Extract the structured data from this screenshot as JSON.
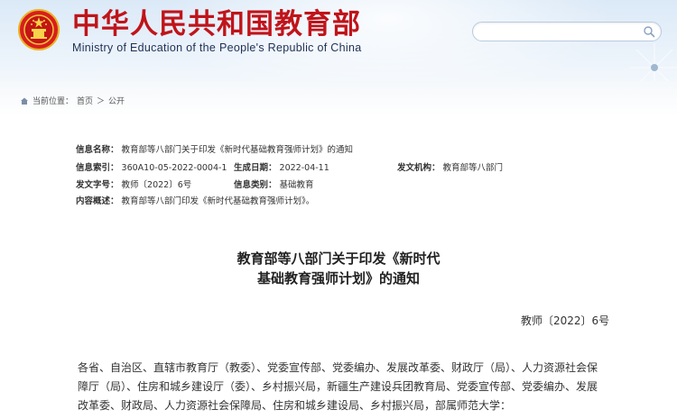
{
  "header": {
    "title": "中华人民共和国教育部",
    "subtitle": "Ministry of Education of the People's Republic of China",
    "search_placeholder": ""
  },
  "breadcrumb": {
    "current_location_label": "当前位置：",
    "home": "首页",
    "separator": "＞",
    "section": "公开"
  },
  "meta": {
    "name_label": "信息名称：",
    "name_value": "教育部等八部门关于印发《新时代基础教育强师计划》的通知",
    "index_label": "信息索引：",
    "index_value": "360A10-05-2022-0004-1",
    "date_label": "生成日期：",
    "date_value": "2022-04-11",
    "issuer_label": "发文机构：",
    "issuer_value": "教育部等八部门",
    "docno_label": "发文字号：",
    "docno_value": "教师〔2022〕6号",
    "category_label": "信息类别：",
    "category_value": "基础教育",
    "summary_label": "内容概述：",
    "summary_value": "教育部等八部门印发《新时代基础教育强师计划》。"
  },
  "document": {
    "title_line1": "教育部等八部门关于印发《新时代",
    "title_line2": "基础教育强师计划》的通知",
    "number": "教师〔2022〕6号",
    "body": "各省、自治区、直辖市教育厅（教委）、党委宣传部、党委编办、发展改革委、财政厅（局）、人力资源社会保障厅（局）、住房和城乡建设厅（委）、乡村振兴局，新疆生产建设兵团教育局、党委宣传部、党委编办、发展改革委、财政局、人力资源社会保障局、住房和城乡建设局、乡村振兴局，部属师范大学："
  },
  "colors": {
    "title_red": "#c0141a",
    "header_bg": "#dbe9f7"
  },
  "icons": {
    "emblem": "national-emblem-icon",
    "search": "search-icon",
    "breadcrumb_home": "home-icon"
  }
}
